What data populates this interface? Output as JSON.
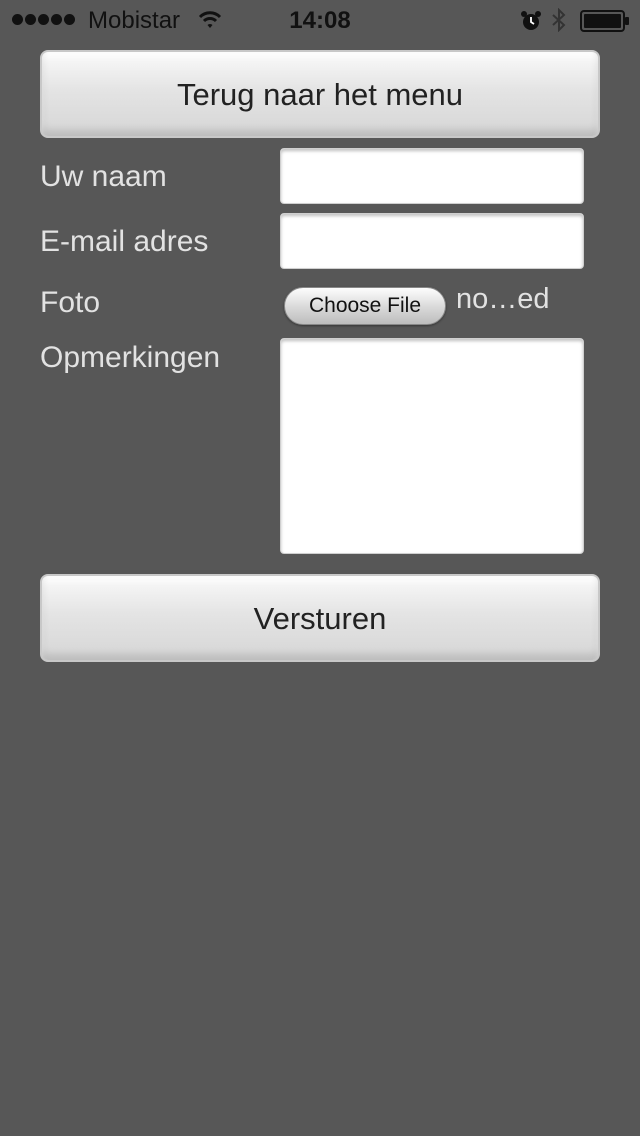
{
  "status_bar": {
    "carrier": "Mobistar",
    "time": "14:08",
    "signal_icon": "signal-dots-icon",
    "wifi_icon": "wifi-icon",
    "alarm_icon": "alarm-icon",
    "bluetooth_icon": "bluetooth-icon",
    "battery_icon": "battery-icon"
  },
  "nav": {
    "back_label": "Terug naar het menu"
  },
  "form": {
    "name_label": "Uw naam",
    "name_value": "",
    "email_label": "E-mail adres",
    "email_value": "",
    "photo_label": "Foto",
    "choose_file_label": "Choose File",
    "file_status": "no…ed",
    "remarks_label": "Opmerkingen",
    "remarks_value": ""
  },
  "actions": {
    "submit_label": "Versturen"
  },
  "colors": {
    "background": "#575757",
    "label_text": "#e2e2e2",
    "button_text": "#222222"
  }
}
